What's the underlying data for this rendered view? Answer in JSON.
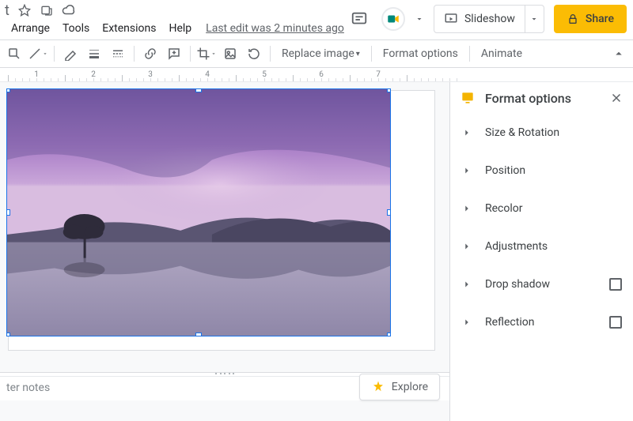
{
  "title_letter": "t",
  "menus": [
    "Arrange",
    "Tools",
    "Extensions",
    "Help"
  ],
  "last_edit": "Last edit was 2 minutes ago",
  "top_right": {
    "slideshow_label": "Slideshow",
    "share_label": "Share"
  },
  "toolbar": {
    "replace_image": "Replace image",
    "format_options": "Format options",
    "animate": "Animate"
  },
  "ruler_labels": [
    "1",
    "2",
    "3",
    "4",
    "5",
    "6",
    "7"
  ],
  "speaker_notes_placeholder": "ter notes",
  "explore_label": "Explore",
  "sidebar": {
    "title": "Format options",
    "sections": [
      {
        "label": "Size & Rotation",
        "checkbox": false
      },
      {
        "label": "Position",
        "checkbox": false
      },
      {
        "label": "Recolor",
        "checkbox": false
      },
      {
        "label": "Adjustments",
        "checkbox": false
      },
      {
        "label": "Drop shadow",
        "checkbox": true
      },
      {
        "label": "Reflection",
        "checkbox": true
      }
    ]
  }
}
